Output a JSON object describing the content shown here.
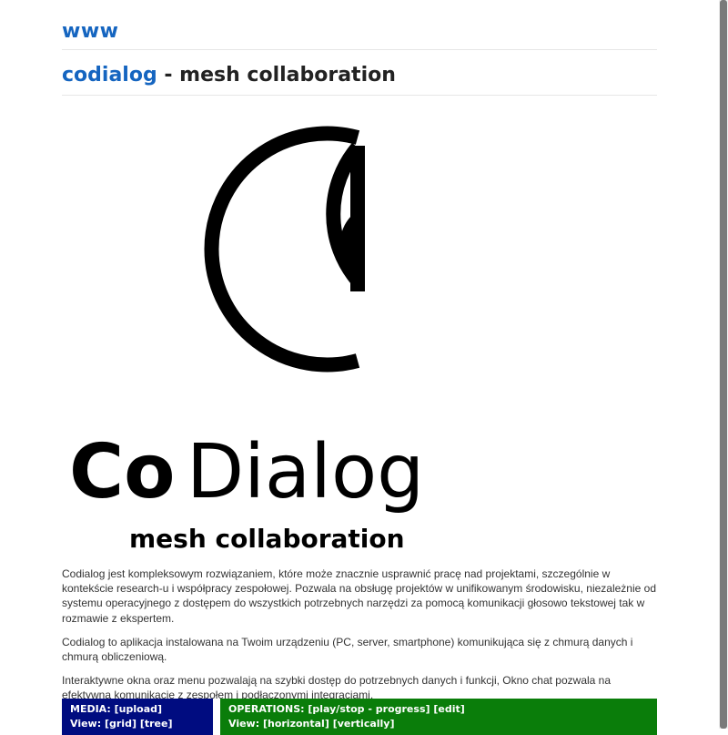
{
  "header": {
    "site_link": "www"
  },
  "title": {
    "brand_link": "codialog",
    "rest": " - mesh collaboration"
  },
  "logo": {
    "wordmark_bold": "Co",
    "wordmark_light": "Dialog",
    "tagline": "mesh collaboration"
  },
  "description": {
    "p1": "Codialog jest kompleksowym rozwiązaniem, które może znacznie usprawnić pracę nad projektami, szczególnie w kontekście research-u i współpracy zespołowej. Pozwala na obsługę projektów w unifikowanym środowisku, niezależnie od systemu operacyjnego z dostępem do wszystkich potrzebnych narzędzi za pomocą komunikacji głosowo tekstowej tak w rozmawie z ekspertem.",
    "p2": "Codialog to aplikacja instalowana na Twoim urządzeniu (PC, server, smartphone) komunikująca się z chmurą danych i chmurą obliczeniową.",
    "p3": "Interaktywne okna oraz menu pozwalają na szybki dostęp do potrzebnych danych i funkcji, Okno chat pozwala na efektywną komunikację z zespołem i podłączonymi integracjami."
  },
  "panels": {
    "media": {
      "label": "MEDIA:",
      "upload": "[upload]",
      "view_label": "View:",
      "grid": "[grid]",
      "tree": "[tree]"
    },
    "operations": {
      "label": "OPERATIONS:",
      "play_stop": "[play/stop - progress]",
      "edit": "[edit]",
      "view_label": "View:",
      "horizontal": "[horizontal]",
      "vertically": "[vertically]"
    }
  },
  "colors": {
    "link": "#1565c0",
    "media_panel": "#000c80",
    "operations_panel": "#0a7d0a"
  }
}
